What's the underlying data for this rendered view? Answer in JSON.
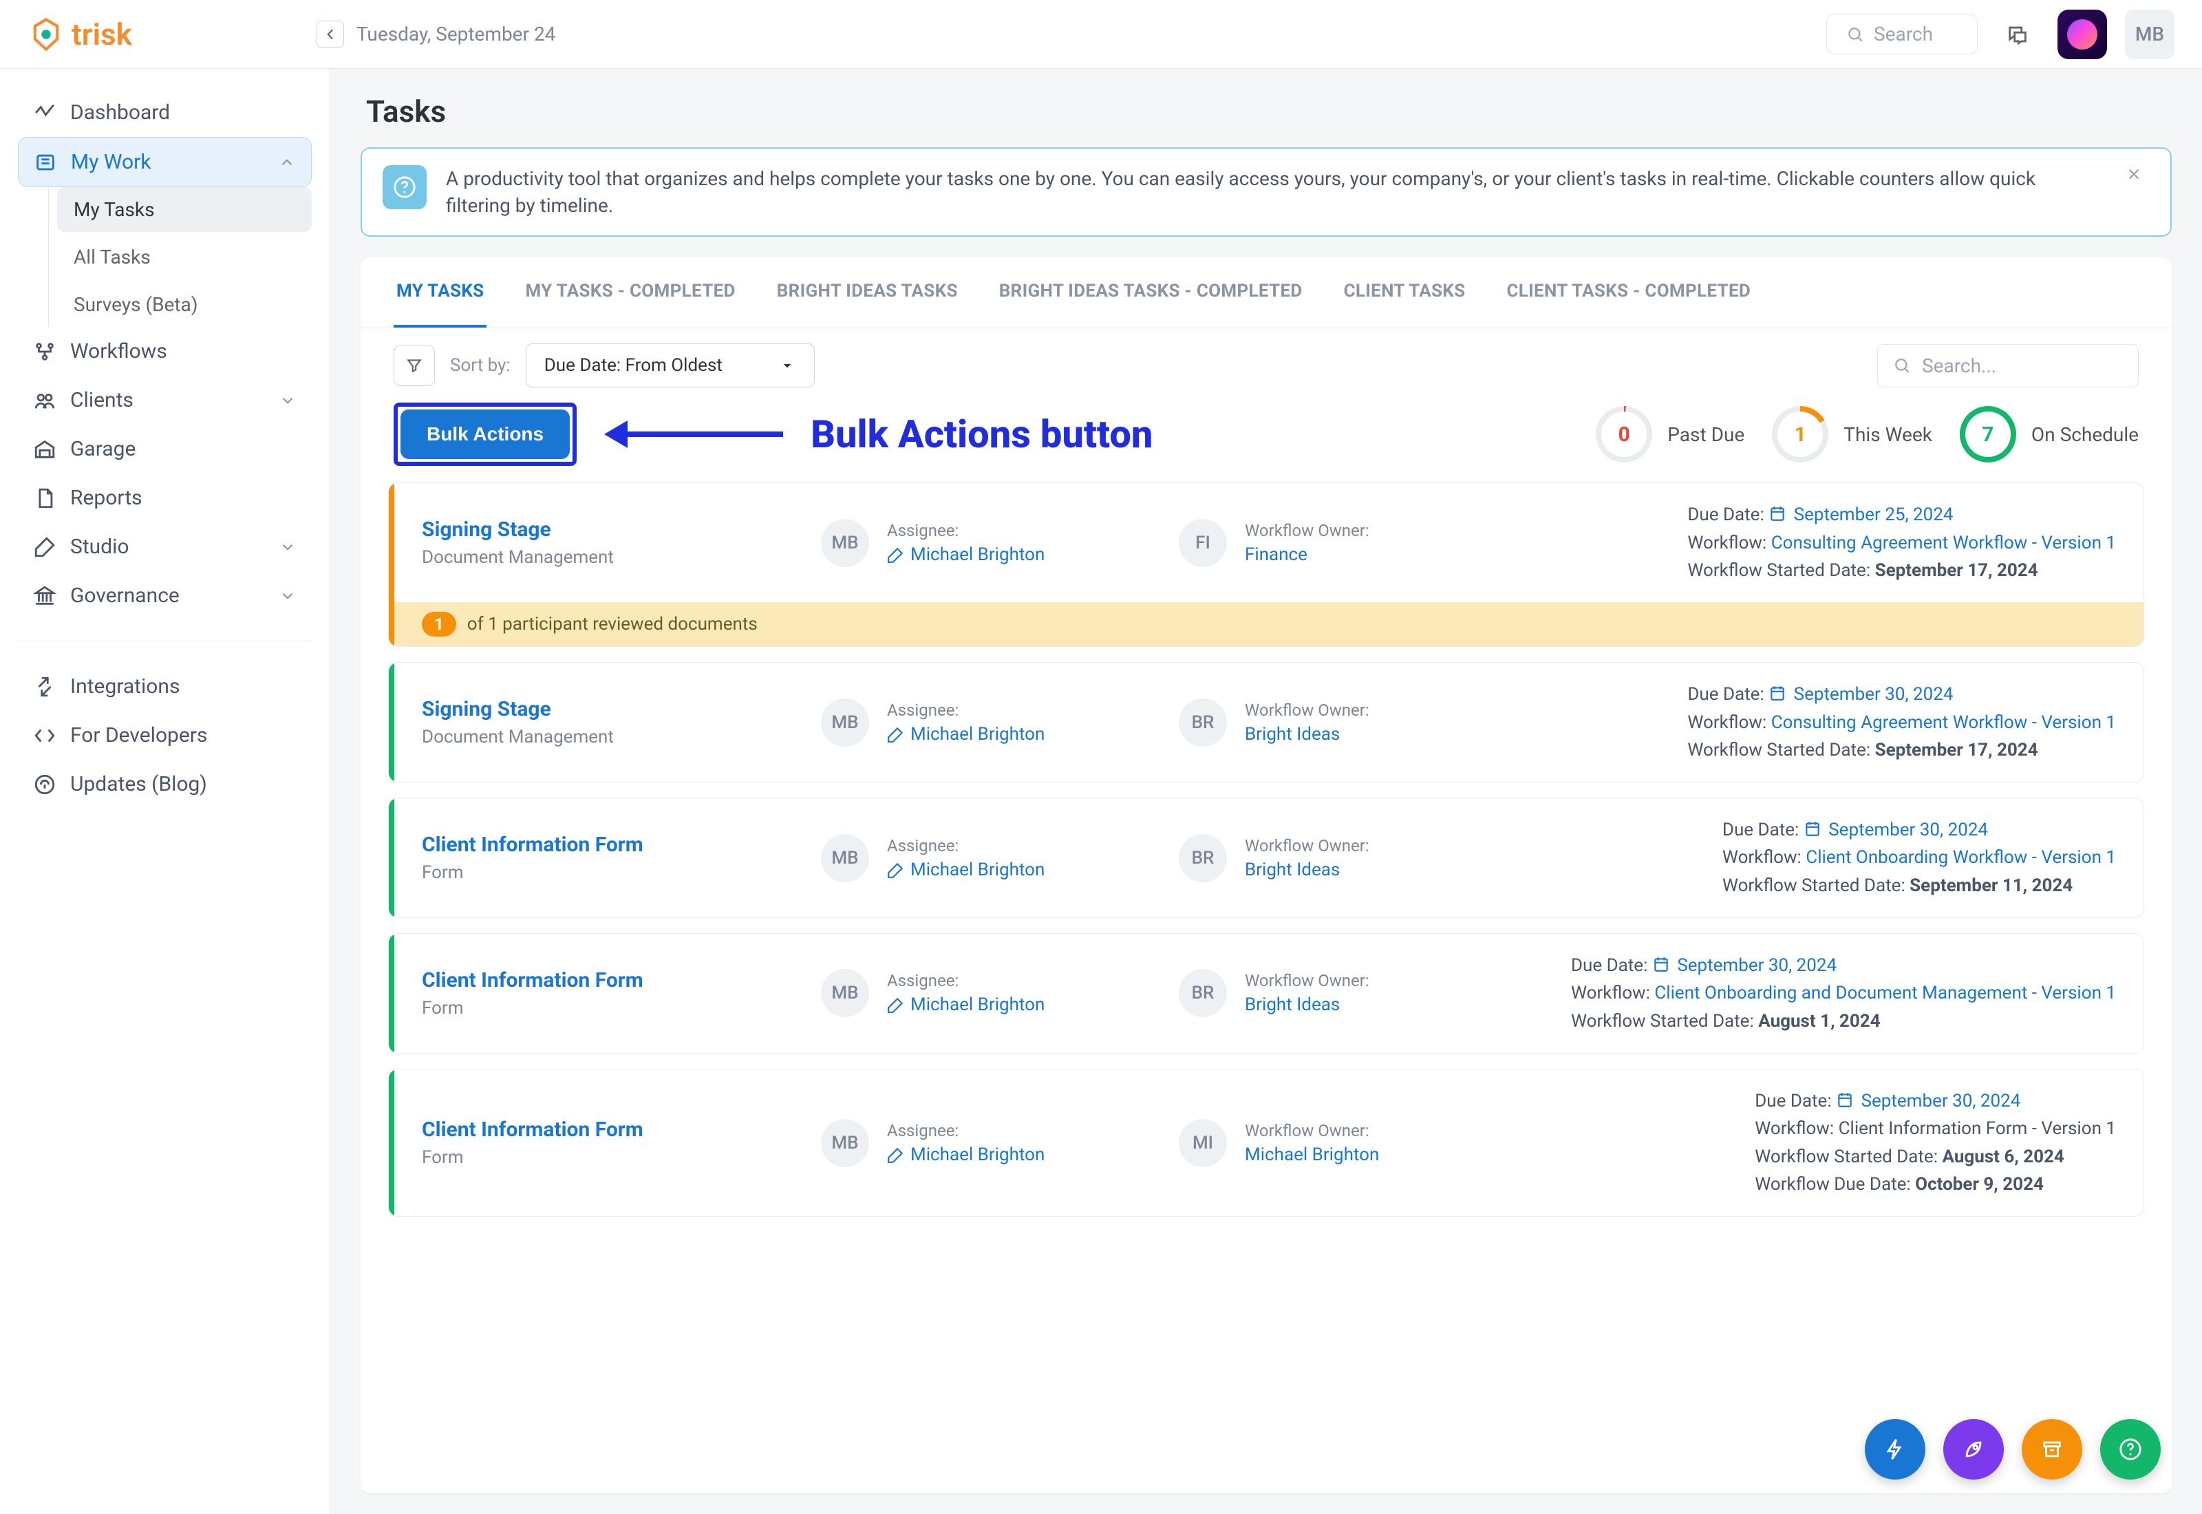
{
  "header": {
    "brand": "trisk",
    "date": "Tuesday, September 24",
    "search_placeholder": "Search",
    "user_initials": "MB"
  },
  "sidebar": {
    "items": [
      {
        "icon": "dashboard",
        "label": "Dashboard"
      },
      {
        "icon": "mywork",
        "label": "My Work",
        "active": true,
        "expanded": true,
        "children": [
          "My Tasks",
          "All Tasks",
          "Surveys (Beta)"
        ],
        "current": "My Tasks"
      },
      {
        "icon": "workflows",
        "label": "Workflows"
      },
      {
        "icon": "clients",
        "label": "Clients",
        "expandable": true
      },
      {
        "icon": "garage",
        "label": "Garage"
      },
      {
        "icon": "reports",
        "label": "Reports"
      },
      {
        "icon": "studio",
        "label": "Studio",
        "expandable": true
      },
      {
        "icon": "governance",
        "label": "Governance",
        "expandable": true
      }
    ],
    "secondary": [
      {
        "icon": "integrations",
        "label": "Integrations"
      },
      {
        "icon": "developers",
        "label": "For Developers"
      },
      {
        "icon": "updates",
        "label": "Updates (Blog)"
      }
    ]
  },
  "page": {
    "title": "Tasks",
    "help_text": "A productivity tool that organizes and helps complete your tasks one by one. You can easily access yours, your company's, or your client's tasks in real-time. Clickable counters allow quick filtering by timeline.",
    "tabs": [
      "MY TASKS",
      "MY TASKS - COMPLETED",
      "BRIGHT IDEAS TASKS",
      "BRIGHT IDEAS TASKS - COMPLETED",
      "CLIENT TASKS",
      "CLIENT TASKS - COMPLETED"
    ],
    "active_tab": 0,
    "sort_label": "Sort by:",
    "sort_value": "Due Date: From Oldest",
    "task_search_placeholder": "Search...",
    "bulk_actions_label": "Bulk Actions",
    "annotation": "Bulk Actions button",
    "counters": [
      {
        "value": "0",
        "label": "Past Due",
        "color": "red"
      },
      {
        "value": "1",
        "label": "This Week",
        "color": "orange"
      },
      {
        "value": "7",
        "label": "On Schedule",
        "color": "green"
      }
    ],
    "col_labels": {
      "assignee": "Assignee:",
      "owner": "Workflow Owner:",
      "due": "Due Date:",
      "workflow": "Workflow:",
      "started": "Workflow Started Date:",
      "wfdue": "Workflow Due Date:"
    },
    "participant_text": "of 1 participant reviewed documents",
    "participant_count": "1",
    "tasks": [
      {
        "edge": "orange",
        "title": "Signing Stage",
        "sub": "Document Management",
        "assignee_initials": "MB",
        "assignee": "Michael Brighton",
        "owner_initials": "FI",
        "owner": "Finance",
        "due": "September 25, 2024",
        "workflow": "Consulting Agreement Workflow - Version 1",
        "workflow_is_link": true,
        "started": "September 17, 2024",
        "banner": true
      },
      {
        "edge": "green",
        "title": "Signing Stage",
        "sub": "Document Management",
        "assignee_initials": "MB",
        "assignee": "Michael Brighton",
        "owner_initials": "BR",
        "owner": "Bright Ideas",
        "due": "September 30, 2024",
        "workflow": "Consulting Agreement Workflow - Version 1",
        "workflow_is_link": true,
        "started": "September 17, 2024"
      },
      {
        "edge": "green",
        "title": "Client Information Form",
        "sub": "Form",
        "assignee_initials": "MB",
        "assignee": "Michael Brighton",
        "owner_initials": "BR",
        "owner": "Bright Ideas",
        "due": "September 30, 2024",
        "workflow": "Client Onboarding Workflow - Version 1",
        "workflow_is_link": true,
        "started": "September 11, 2024"
      },
      {
        "edge": "green",
        "title": "Client Information Form",
        "sub": "Form",
        "assignee_initials": "MB",
        "assignee": "Michael Brighton",
        "owner_initials": "BR",
        "owner": "Bright Ideas",
        "due": "September 30, 2024",
        "workflow": "Client Onboarding and Document Management - Version 1",
        "workflow_is_link": true,
        "started": "August 1, 2024"
      },
      {
        "edge": "green",
        "title": "Client Information Form",
        "sub": "Form",
        "assignee_initials": "MB",
        "assignee": "Michael Brighton",
        "owner_initials": "MI",
        "owner": "Michael Brighton",
        "due": "September 30, 2024",
        "workflow": "Client Information Form - Version 1",
        "workflow_is_link": false,
        "started": "August 6, 2024",
        "wfdue": "October 9, 2024"
      }
    ]
  }
}
